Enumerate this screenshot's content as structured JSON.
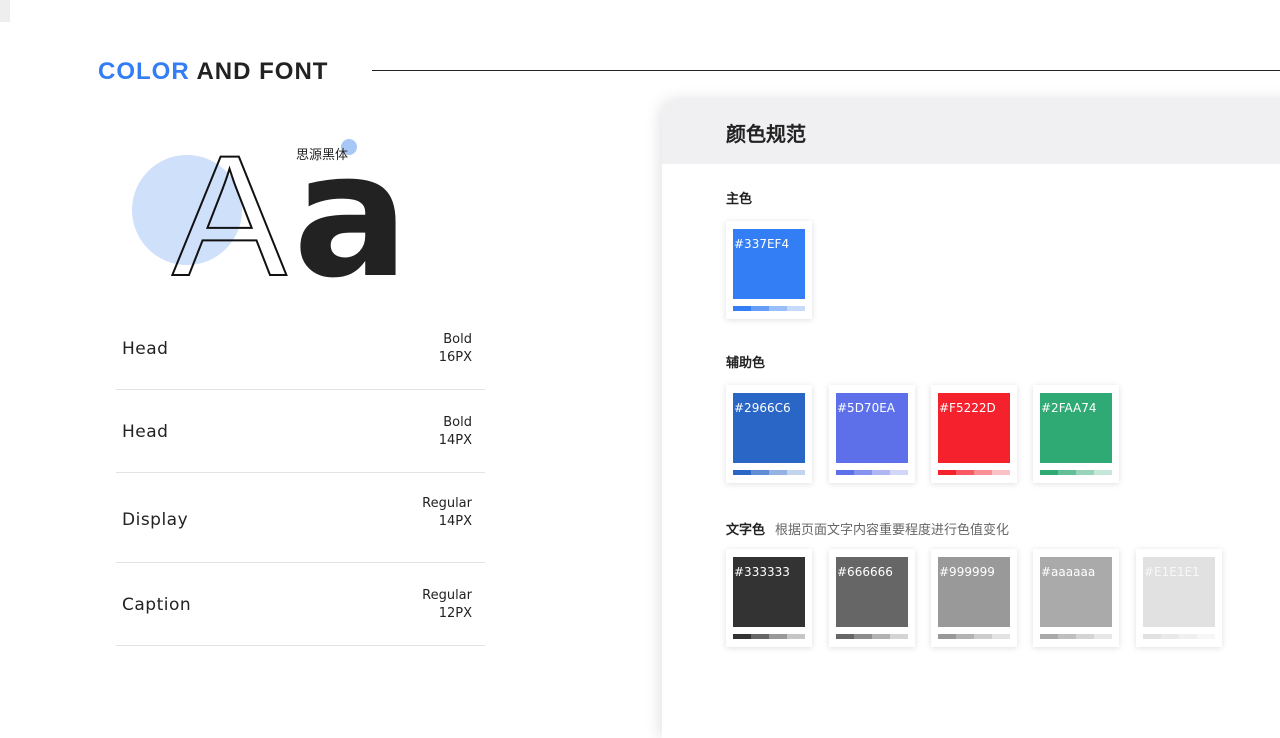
{
  "header": {
    "title_accent": "COLOR",
    "title_rest": "AND FONT"
  },
  "specimen": {
    "font_name": "思源黑体",
    "glyph_upper": "A",
    "glyph_lower": "a"
  },
  "type_scale": [
    {
      "name": "Head",
      "weight": "Bold",
      "size": "16PX"
    },
    {
      "name": "Head",
      "weight": "Bold",
      "size": "14PX"
    },
    {
      "name": "Display",
      "weight": "Regular",
      "size": "14PX"
    },
    {
      "name": "Caption",
      "weight": "Regular",
      "size": "12PX"
    }
  ],
  "panel": {
    "title": "颜色规范",
    "primary": {
      "label": "主色",
      "colors": [
        {
          "hex": "#337EF4",
          "color": "#337EF4"
        }
      ]
    },
    "secondary": {
      "label": "辅助色",
      "colors": [
        {
          "hex": "#2966C6",
          "color": "#2966C6"
        },
        {
          "hex": "#5D70EA",
          "color": "#5D70EA"
        },
        {
          "hex": "#F5222D",
          "color": "#F5222D"
        },
        {
          "hex": "#2FAA74",
          "color": "#2FAA74"
        }
      ]
    },
    "text_colors": {
      "label": "文字色",
      "note": "根据页面文字内容重要程度进行色值变化",
      "colors": [
        {
          "hex": "#333333",
          "color": "#333333"
        },
        {
          "hex": "#666666",
          "color": "#666666"
        },
        {
          "hex": "#999999",
          "color": "#999999"
        },
        {
          "hex": "#aaaaaa",
          "color": "#aaaaaa"
        },
        {
          "hex": "#E1E1E1",
          "color": "#E1E1E1"
        }
      ]
    }
  }
}
